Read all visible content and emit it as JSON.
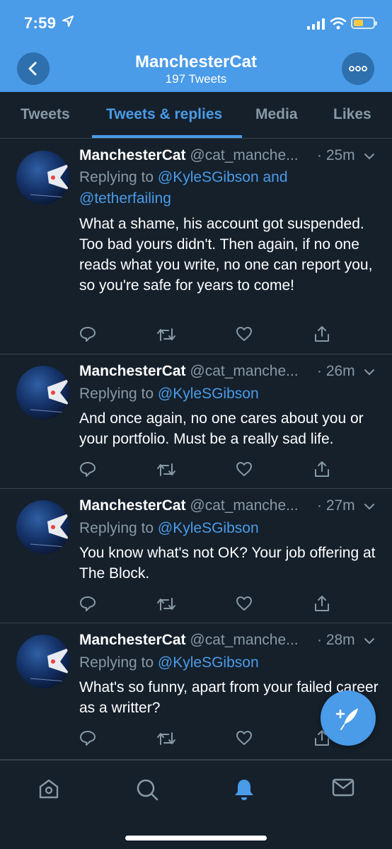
{
  "status_bar": {
    "time": "7:59"
  },
  "header": {
    "title": "ManchesterCat",
    "subtitle": "197 Tweets"
  },
  "tabs": [
    {
      "label": "Tweets"
    },
    {
      "label": "Tweets & replies"
    },
    {
      "label": "Media"
    },
    {
      "label": "Likes"
    }
  ],
  "active_tab": "Tweets & replies",
  "colors": {
    "accent": "#4a9be8",
    "background": "#15202b",
    "muted": "#8899a6",
    "divider": "#38444d"
  },
  "tweets": [
    {
      "name": "ManchesterCat",
      "handle": "@cat_manche...",
      "time": "· 25m",
      "reply_prefix": "Replying to",
      "mention1": "@KyleSGibson",
      "conj": "and",
      "mention2": "@tetherfailing",
      "text": "What a shame, his account got suspended. Too bad yours didn't. Then again, if no one reads what you write, no one can report you, so you're safe for years to come!"
    },
    {
      "name": "ManchesterCat",
      "handle": "@cat_manche...",
      "time": "· 26m",
      "reply_prefix": "Replying to",
      "mention1": "@KyleSGibson",
      "text": "And once again, no one cares about you or your portfolio. Must be a really sad life."
    },
    {
      "name": "ManchesterCat",
      "handle": "@cat_manche...",
      "time": "· 27m",
      "reply_prefix": "Replying to",
      "mention1": "@KyleSGibson",
      "text": "You know what's not OK? Your job offering at The Block."
    },
    {
      "name": "ManchesterCat",
      "handle": "@cat_manche...",
      "time": "· 28m",
      "reply_prefix": "Replying to",
      "mention1": "@KyleSGibson",
      "text": "What's so funny, apart from your failed career as a writter?"
    }
  ],
  "icons": {
    "back": "chevron-left-icon",
    "more": "more-icon",
    "reply": "reply-icon",
    "retweet": "retweet-icon",
    "like": "heart-icon",
    "share": "share-icon",
    "compose": "compose-tweet-icon",
    "nav": [
      "home-icon",
      "search-icon",
      "notifications-icon",
      "messages-icon"
    ]
  }
}
